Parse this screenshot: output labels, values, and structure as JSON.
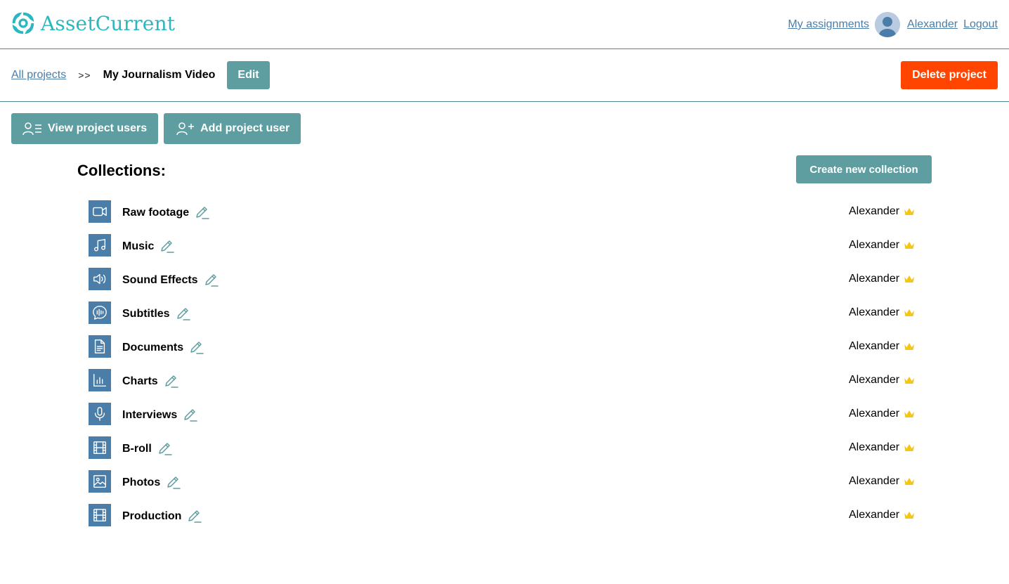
{
  "header": {
    "logo_text": "AssetCurrent",
    "my_assignments": "My assignments",
    "username": "Alexander",
    "logout": "Logout"
  },
  "project": {
    "all_projects": "All projects",
    "separator": ">>",
    "name": "My Journalism Video",
    "edit_label": "Edit",
    "delete_label": "Delete project"
  },
  "user_buttons": {
    "view_users": "View project users",
    "add_user": "Add project user"
  },
  "collections": {
    "title": "Collections:",
    "create_label": "Create new collection",
    "items": [
      {
        "name": "Raw footage",
        "icon": "video-camera-icon",
        "owner": "Alexander"
      },
      {
        "name": "Music",
        "icon": "music-note-icon",
        "owner": "Alexander"
      },
      {
        "name": "Sound Effects",
        "icon": "speaker-icon",
        "owner": "Alexander"
      },
      {
        "name": "Subtitles",
        "icon": "speech-bubble-icon",
        "owner": "Alexander"
      },
      {
        "name": "Documents",
        "icon": "document-icon",
        "owner": "Alexander"
      },
      {
        "name": "Charts",
        "icon": "bar-chart-icon",
        "owner": "Alexander"
      },
      {
        "name": "Interviews",
        "icon": "microphone-icon",
        "owner": "Alexander"
      },
      {
        "name": "B-roll",
        "icon": "film-icon",
        "owner": "Alexander"
      },
      {
        "name": "Photos",
        "icon": "image-icon",
        "owner": "Alexander"
      },
      {
        "name": "Production",
        "icon": "film-icon",
        "owner": "Alexander"
      }
    ]
  },
  "colors": {
    "teal": "#5f9ea0",
    "blue": "#4a7ea8",
    "danger": "#ff4500",
    "logo": "#2bb7bf",
    "crown": "#f5c518"
  }
}
